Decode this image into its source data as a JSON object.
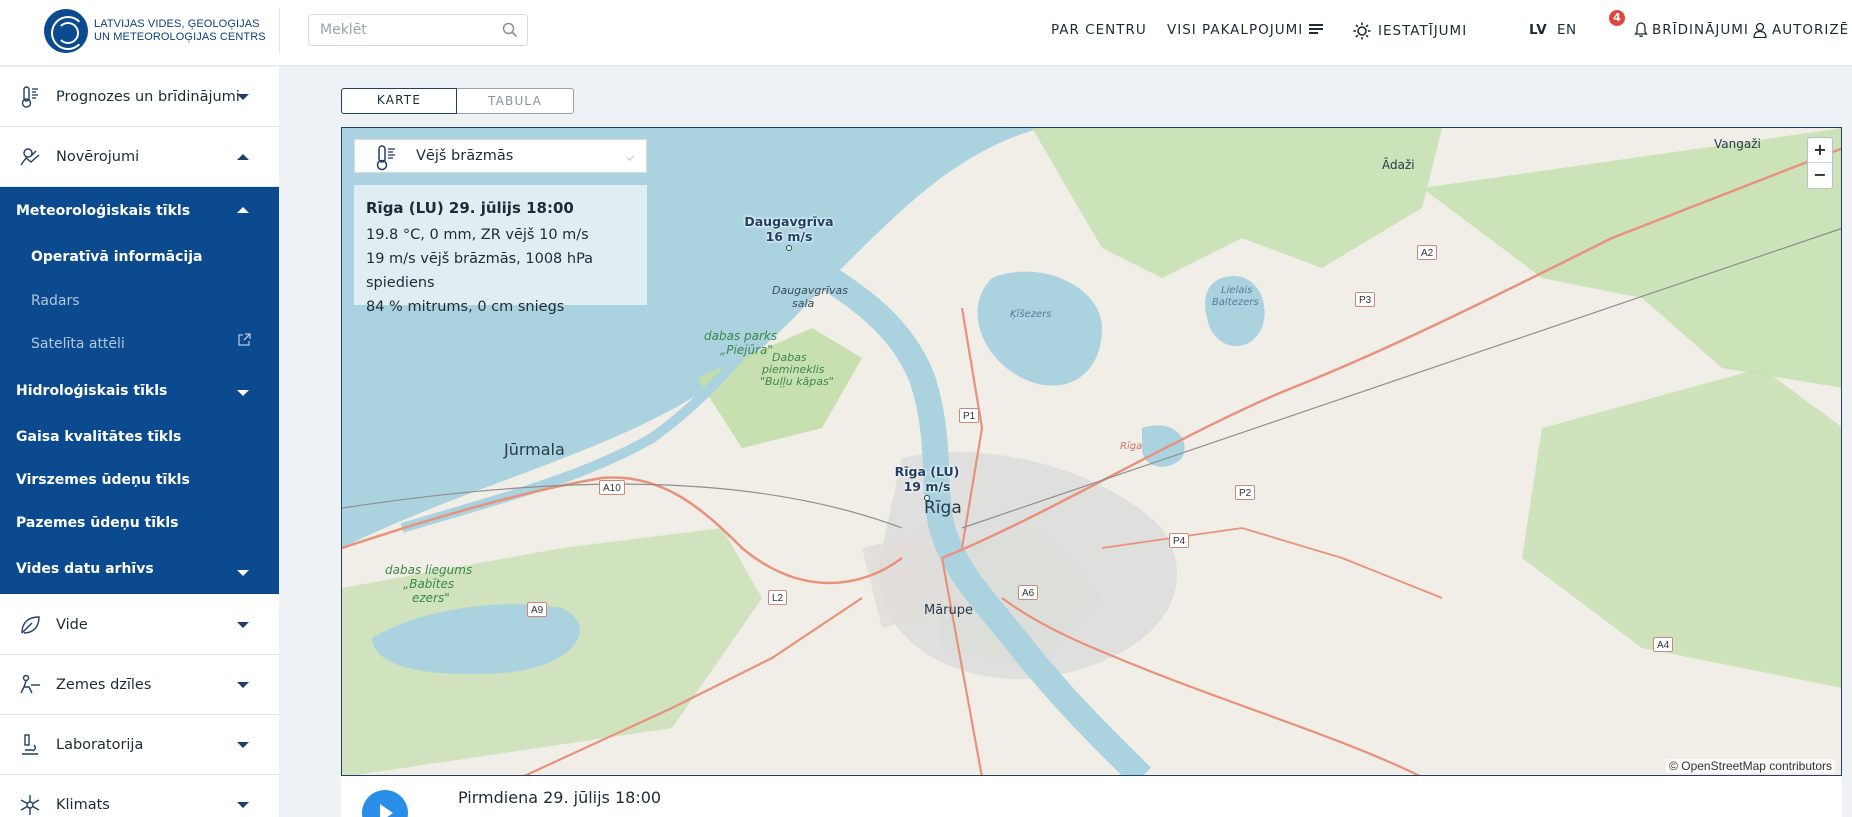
{
  "header": {
    "logo_line1": "LATVIJAS VIDES, ĢEOLOĢIJAS",
    "logo_line2": "UN METEOROLOĢIJAS CENTRS",
    "search_placeholder": "Meklēt",
    "nav": {
      "about": "PAR CENTRU",
      "services": "VISI PAKALPOJUMI",
      "settings": "IESTATĪJUMI",
      "lang_lv": "LV",
      "lang_en": "EN",
      "warnings": "BRĪDINĀJUMI",
      "warnings_count": "4",
      "login": "AUTORIZĒ"
    }
  },
  "sidebar": {
    "forecasts": "Prognozes un brīdinājumi",
    "observations": "Novērojumi",
    "met_network": "Meteoroloģiskais tīkls",
    "operational": "Operatīvā informācija",
    "radar": "Radars",
    "satellite": "Satelīta attēli",
    "hydro": "Hidroloģiskais tīkls",
    "air": "Gaisa kvalitātes tīkls",
    "surface_water": "Virszemes ūdeņu tīkls",
    "groundwater": "Pazemes ūdeņu tīkls",
    "archive": "Vides datu arhīvs",
    "environment": "Vide",
    "earth": "Zemes dzīles",
    "lab": "Laboratorija",
    "climate": "Klimats"
  },
  "tabs": {
    "map": "KARTE",
    "table": "TABULA"
  },
  "map": {
    "layer": "Vējš brāzmās",
    "info": {
      "title": "Rīga (LU) 29. jūlijs 18:00",
      "line1": "19.8 °C, 0 mm, ZR vējš 10 m/s",
      "line2": "19 m/s vējš brāzmās, 1008 hPa spiediens",
      "line3": "84 % mitrums, 0 cm sniegs"
    },
    "stations": [
      {
        "name": "Daugavgrīva",
        "value": "16 m/s"
      },
      {
        "name": "Rīga (LU)",
        "value": "19 m/s"
      }
    ],
    "places": {
      "jurmala": "Jūrmala",
      "riga": "Rīga",
      "marupe": "Mārupe",
      "adazi": "Ādaži",
      "vangazi": "Vangaži",
      "daugavgrivas_sala_1": "Daugavgrīvas",
      "daugavgrivas_sala_2": "sala",
      "piejura_1": "dabas parks",
      "piejura_2": "„Piejūra\"",
      "bullu_1": "Dabas",
      "bullu_2": "piemineklis",
      "bullu_3": "\"Buļļu kāpas\"",
      "babites_1": "dabas liegums",
      "babites_2": "„Babītes",
      "babites_3": "ezers\"",
      "kisezers": "Ķīšezers",
      "baltezers_1": "Lielais",
      "baltezers_2": "Baltezers",
      "riga_small": "Rīga"
    },
    "roads": [
      "A10",
      "A9",
      "L2",
      "P1",
      "A6",
      "P4",
      "P2",
      "P3",
      "A2",
      "A4"
    ],
    "zoom_in": "+",
    "zoom_out": "−",
    "attribution": "© OpenStreetMap contributors"
  },
  "timeline": {
    "label": "Pirmdiena 29. jūlijs 18:00"
  }
}
